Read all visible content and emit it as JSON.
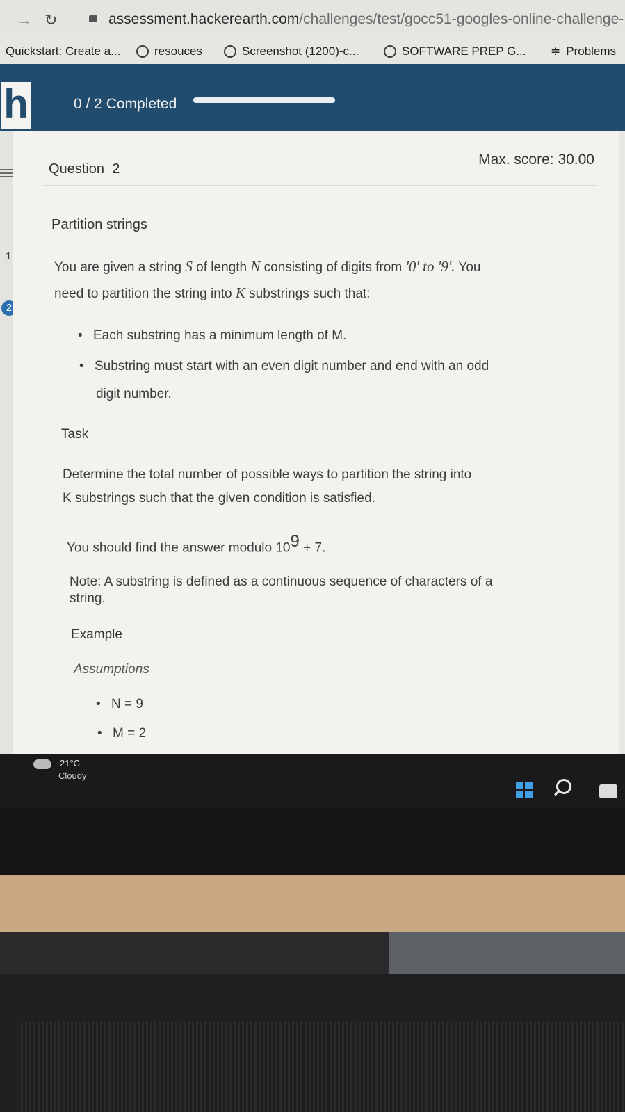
{
  "browser": {
    "url_host": "assessment.hackerearth.com",
    "url_path": "/challenges/test/gocc51-googles-online-challenge-",
    "bookmarks": [
      {
        "label": "Quickstart: Create a..."
      },
      {
        "label": "resouces"
      },
      {
        "label": "Screenshot (1200)-c..."
      },
      {
        "label": "SOFTWARE PREP G..."
      },
      {
        "label": "Problems"
      }
    ]
  },
  "header": {
    "logo_letter": "h",
    "progress_label": "0 / 2 Completed",
    "progress_fraction": 0.0
  },
  "sidebar": {
    "questions": [
      "1",
      "2"
    ],
    "active": "2"
  },
  "question": {
    "label": "Question",
    "number": "2",
    "max_score": "Max. score: 30.00",
    "title": "Partition strings",
    "intro_line1_a": "You are given a string ",
    "intro_S": "S",
    "intro_line1_b": " of length ",
    "intro_N": "N",
    "intro_line1_c": " consisting of digits from ",
    "intro_range": "'0' to '9'.",
    "intro_line1_d": " You",
    "intro_line2_a": "need to partition the string into ",
    "intro_K": "K",
    "intro_line2_b": " substrings such that:",
    "bullets": [
      "Each substring has a minimum length of M.",
      "Substring must start with an even digit number and end with an odd",
      "digit number."
    ],
    "task_heading": "Task",
    "task_line1": "Determine the total number of possible ways to partition the string into",
    "task_line2": "K substrings such that the given condition is satisfied.",
    "modulo_text": "You should find the answer modulo 10",
    "modulo_exp": "9",
    "modulo_tail": " + 7.",
    "note_line1": "Note: A substring is defined as a continuous sequence of characters of a",
    "note_line2": "string.",
    "example_heading": "Example",
    "assumptions_heading": "Assumptions",
    "assumptions": [
      "N = 9",
      "M = 2"
    ]
  },
  "taskbar": {
    "temperature": "21°C",
    "condition": "Cloudy"
  }
}
